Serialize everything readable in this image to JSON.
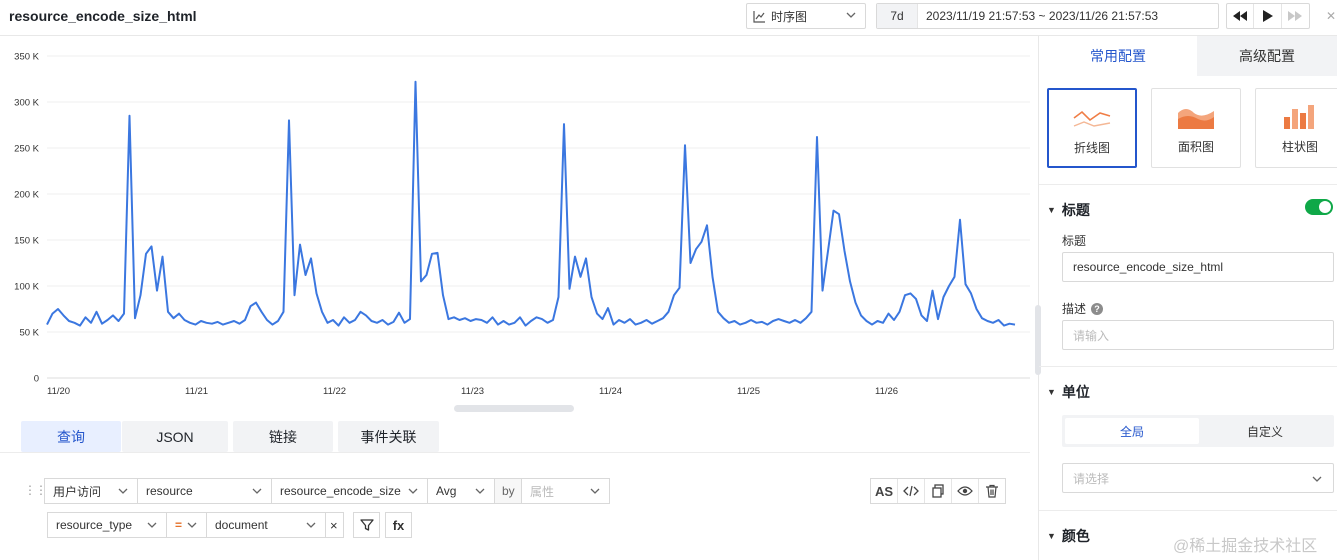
{
  "header": {
    "title": "resource_encode_size_html",
    "viz_type": "时序图",
    "range_preset": "7d",
    "range_text": "2023/11/19 21:57:53 ~ 2023/11/26 21:57:53"
  },
  "chart_data": {
    "type": "line",
    "y_ticks": [
      "350 K",
      "300 K",
      "250 K",
      "200 K",
      "150 K",
      "100 K",
      "50 K",
      "0"
    ],
    "x_ticks": [
      "11/20",
      "11/21",
      "11/22",
      "11/23",
      "11/24",
      "11/25",
      "11/26"
    ],
    "ylim": [
      0,
      350000
    ],
    "grid": true,
    "color": "#3b77e0",
    "series": [
      {
        "values": [
          58000,
          70000,
          75000,
          68000,
          62000,
          60000,
          57000,
          66000,
          60000,
          72000,
          59000,
          63000,
          68000,
          62000,
          70000,
          285000,
          65000,
          90000,
          135000,
          143000,
          95000,
          132000,
          72000,
          65000,
          70000,
          63000,
          60000,
          58000,
          62000,
          60000,
          59000,
          61000,
          58000,
          60000,
          62000,
          59000,
          63000,
          78000,
          82000,
          72000,
          63000,
          58000,
          62000,
          72000,
          280000,
          90000,
          145000,
          112000,
          130000,
          92000,
          72000,
          60000,
          63000,
          57000,
          66000,
          60000,
          63000,
          72000,
          68000,
          62000,
          60000,
          63000,
          58000,
          61000,
          71000,
          60000,
          64000,
          322000,
          105000,
          112000,
          135000,
          136000,
          90000,
          64000,
          66000,
          63000,
          65000,
          62000,
          64000,
          63000,
          60000,
          66000,
          58000,
          62000,
          58000,
          60000,
          66000,
          57000,
          62000,
          66000,
          64000,
          60000,
          63000,
          88000,
          276000,
          97000,
          132000,
          110000,
          130000,
          88000,
          70000,
          64000,
          76000,
          58000,
          63000,
          60000,
          64000,
          58000,
          60000,
          63000,
          59000,
          62000,
          65000,
          72000,
          90000,
          98000,
          253000,
          125000,
          140000,
          148000,
          166000,
          110000,
          72000,
          65000,
          60000,
          62000,
          58000,
          60000,
          63000,
          60000,
          61000,
          58000,
          62000,
          64000,
          62000,
          60000,
          63000,
          60000,
          65000,
          72000,
          262000,
          95000,
          138000,
          182000,
          178000,
          138000,
          105000,
          82000,
          68000,
          62000,
          58000,
          62000,
          60000,
          70000,
          63000,
          72000,
          90000,
          92000,
          86000,
          68000,
          62000,
          95000,
          64000,
          88000,
          100000,
          110000,
          172000,
          102000,
          92000,
          75000,
          65000,
          62000,
          60000,
          63000,
          57000,
          59000,
          58000
        ]
      }
    ]
  },
  "query_tabs": [
    "查询",
    "JSON",
    "链接",
    "事件关联"
  ],
  "query": {
    "source": "用户访问",
    "dataset": "resource",
    "field": "resource_encode_size",
    "aggregate": "Avg",
    "by_label": "by",
    "group_placeholder": "属性",
    "filter_field": "resource_type",
    "filter_op": "=",
    "filter_value": "document",
    "filter_remove": "×",
    "as_label": "AS",
    "fx_label": "fx"
  },
  "panel": {
    "tabs": [
      "常用配置",
      "高级配置"
    ],
    "chart_types": [
      "折线图",
      "面积图",
      "柱状图"
    ],
    "title_section": "标题",
    "title_label": "标题",
    "title_value": "resource_encode_size_html",
    "desc_label": "描述",
    "desc_placeholder": "请输入",
    "unit_section": "单位",
    "unit_options": [
      "全局",
      "自定义"
    ],
    "unit_placeholder": "请选择",
    "color_section": "颜色"
  },
  "watermark": "@稀土掘金技术社区",
  "colors": {
    "accent": "#2456cc",
    "line": "#3b77e0",
    "toggle_on": "#0fa848"
  }
}
